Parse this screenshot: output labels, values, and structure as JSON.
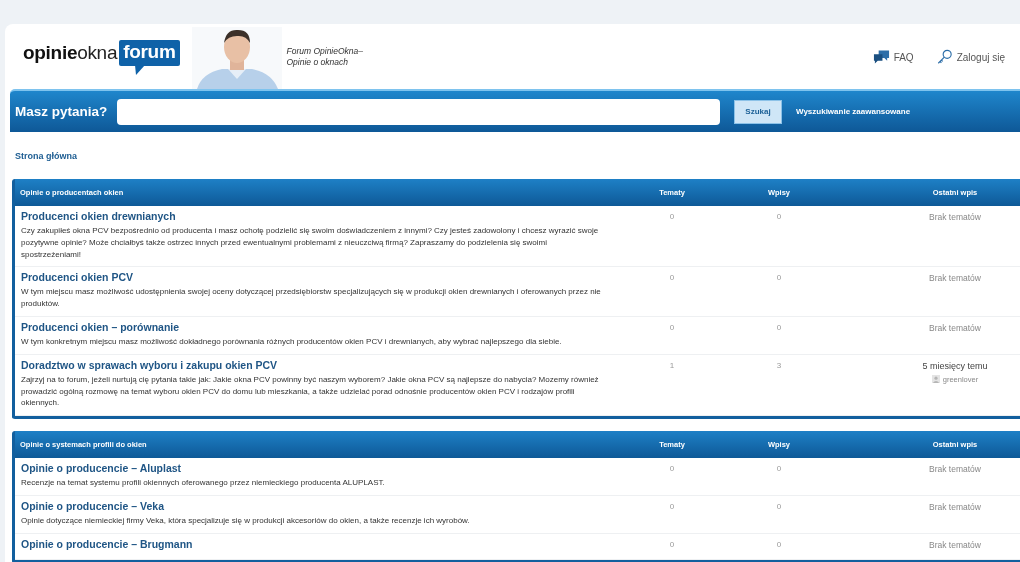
{
  "site": {
    "logo": {
      "part_1": "opinie",
      "part_2": "okna",
      "part_3": "forum"
    },
    "picture": {
      "kind": "picture"
    },
    "tagline": [
      "Forum OpinieOkna–",
      "Opinie o oknach"
    ]
  },
  "header_links": [
    {
      "kind": "faq",
      "label": "FAQ"
    },
    {
      "kind": "login",
      "label": "Zaloguj się"
    }
  ],
  "search": {
    "label": "Masz pytania?",
    "button": "Szukaj",
    "advanced_link": "Wyszukiwanie zaawansowane"
  },
  "breadcrumb": "Strona główna",
  "categories": [
    {
      "title": "Opinie o producentach okien",
      "columns": [
        "Tematy",
        "Wpisy",
        "Ostatni wpis"
      ],
      "forums": [
        {
          "title": "Producenci okien drewnianych",
          "description": "Czy zakupiłeś okna PCV bezpośrednio od producenta i masz ochotę podzielić się swoim doświadczeniem z innymi? Czy jesteś zadowolony i chcesz wyrazić swoje pozytywne opinie? Może chciałbyś także ostrzec innych przed ewentualnymi problemami z nieuczciwą firmą? Zapraszamy do podzielenia się swoimi spostrzeżeniami!",
          "topics": "0",
          "posts": "0",
          "last_post": {
            "text": "Brak tematów"
          }
        },
        {
          "title": "Producenci okien PCV",
          "description": "W tym miejscu masz możliwość udostępnienia swojej oceny dotyczącej przedsiębiorstw specjalizujących się w produkcji okien drewnianych i oferowanych przez nie produktów.",
          "topics": "0",
          "posts": "0",
          "last_post": {
            "text": "Brak tematów"
          }
        },
        {
          "title": "Producenci okien – porównanie",
          "description": "W tym konkretnym miejscu masz możliwość dokładnego porównania różnych producentów okien PCV i drewnianych, aby wybrać najlepszego dla siebie.",
          "topics": "0",
          "posts": "0",
          "last_post": {
            "text": "Brak tematów"
          }
        },
        {
          "title": "Doradztwo w sprawach wyboru i zakupu okien PCV",
          "description": "Zajrzyj na to forum, jeżeli nurtują cię pytania takie jak: Jakie okna PCV powinny być naszym wyborem? Jakie okna PCV są najlepsze do nabycia? Mozemy również prowadzić ogólną rozmowę na temat wyboru okien PCV do domu lub mieszkania, a także udzielać porad odnośnie producentów okien PCV i rodzajów profili okiennych.",
          "topics": "1",
          "posts": "3",
          "last_post": {
            "text": "5 miesięcy temu",
            "user": "greenlover"
          }
        }
      ]
    },
    {
      "title": "Opinie o systemach profili do okien",
      "columns": [
        "Tematy",
        "Wpisy",
        "Ostatni wpis"
      ],
      "forums": [
        {
          "title": "Opinie o producencie – Aluplast",
          "description": "Recenzje na temat systemu profili okiennych oferowanego przez niemieckiego producenta ALUPLAST.",
          "topics": "0",
          "posts": "0",
          "last_post": {
            "text": "Brak tematów"
          }
        },
        {
          "title": "Opinie o producencie – Veka",
          "description": "Opinie dotyczące niemieckiej firmy Veka, która specjalizuje się w produkcji akcesoriów do okien, a także recenzje ich wyrobów.",
          "topics": "0",
          "posts": "0",
          "last_post": {
            "text": "Brak tematów"
          }
        },
        {
          "title": "Opinie o producencie – Brugmann",
          "topics": "0",
          "posts": "0",
          "last_post": {
            "text": "Brak tematów"
          }
        }
      ]
    }
  ]
}
